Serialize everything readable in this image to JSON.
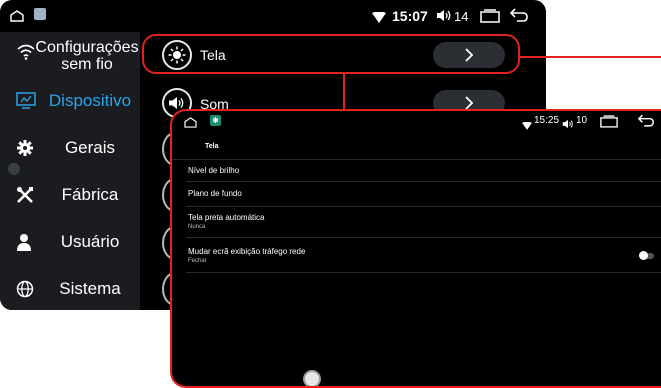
{
  "back": {
    "status": {
      "time": "15:07",
      "volume": "14"
    },
    "sidebar": {
      "items": [
        {
          "label": "Configurações sem fio",
          "icon": "wifi-icon",
          "active": false
        },
        {
          "label": "Dispositivo",
          "icon": "device-icon",
          "active": true
        },
        {
          "label": "Gerais",
          "icon": "gear-icon",
          "active": false
        },
        {
          "label": "Fábrica",
          "icon": "tools-icon",
          "active": false
        },
        {
          "label": "Usuário",
          "icon": "user-icon",
          "active": false
        },
        {
          "label": "Sistema",
          "icon": "globe-icon",
          "active": false
        }
      ]
    },
    "list": [
      {
        "label": "Tela",
        "icon": "brightness-icon"
      },
      {
        "label": "Som",
        "icon": "speaker-icon"
      }
    ]
  },
  "front": {
    "status": {
      "time": "15:25",
      "volume": "10"
    },
    "header_title": "Tela",
    "rows": [
      {
        "title": "Nível de brilho",
        "sub": ""
      },
      {
        "title": "Plano de fundo",
        "sub": ""
      },
      {
        "title": "Tela preta automática",
        "sub": "Nunca"
      },
      {
        "title": "Mudar ecrã exibição tráfego rede",
        "sub": "Fechar",
        "toggle": true
      }
    ]
  },
  "colors": {
    "accent_blue": "#2aa4e8",
    "highlight_red": "#e1221f",
    "panel": "#1a1c20",
    "background": "#000000"
  }
}
